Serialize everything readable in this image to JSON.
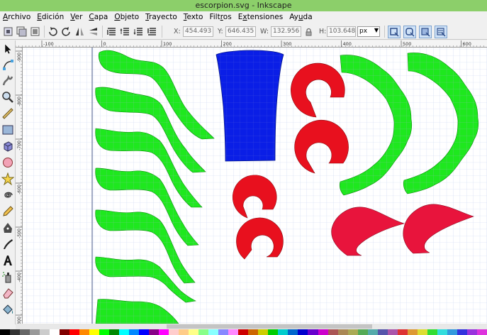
{
  "window": {
    "title": "escorpion.svg - Inkscape"
  },
  "menubar": {
    "items": [
      {
        "pre": "",
        "u": "A",
        "post": "rchivo"
      },
      {
        "pre": "",
        "u": "E",
        "post": "dición"
      },
      {
        "pre": "",
        "u": "V",
        "post": "er"
      },
      {
        "pre": "",
        "u": "C",
        "post": "apa"
      },
      {
        "pre": "",
        "u": "O",
        "post": "bjeto"
      },
      {
        "pre": "",
        "u": "T",
        "post": "rayecto"
      },
      {
        "pre": "",
        "u": "T",
        "post": "exto"
      },
      {
        "pre": "Filt",
        "u": "r",
        "post": "os"
      },
      {
        "pre": "E",
        "u": "x",
        "post": "tensiones"
      },
      {
        "pre": "Ay",
        "u": "u",
        "post": "da"
      }
    ]
  },
  "toolbar": {
    "x_label": "X:",
    "x_value": "454.493",
    "y_label": "Y:",
    "y_value": "646.435",
    "w_label": "W:",
    "w_value": "132.956",
    "h_label": "H:",
    "h_value": "103.648",
    "unit": "px"
  },
  "ruler": {
    "h_ticks": [
      "-100",
      "0",
      "100",
      "200",
      "300",
      "400",
      "500",
      "600",
      "700"
    ],
    "v_ticks": [
      "-900",
      "-800",
      "-700",
      "-600",
      "-500",
      "-400",
      "-300"
    ]
  },
  "colors": {
    "green": "#1ee81e",
    "blue": "#0a1ee6",
    "red": "#e8101e",
    "crimson": "#e8143c",
    "grid": "#c9d6f2"
  },
  "icons": {
    "tools": [
      "selector-icon",
      "node-icon",
      "tweak-icon",
      "zoom-icon",
      "measure-icon",
      "rect-icon",
      "3dbox-icon",
      "ellipse-icon",
      "star-icon",
      "spiral-icon",
      "pencil-icon",
      "pen-icon",
      "calligraphy-icon",
      "text-icon",
      "spray-icon",
      "eraser-icon",
      "paint-bucket-icon"
    ]
  }
}
